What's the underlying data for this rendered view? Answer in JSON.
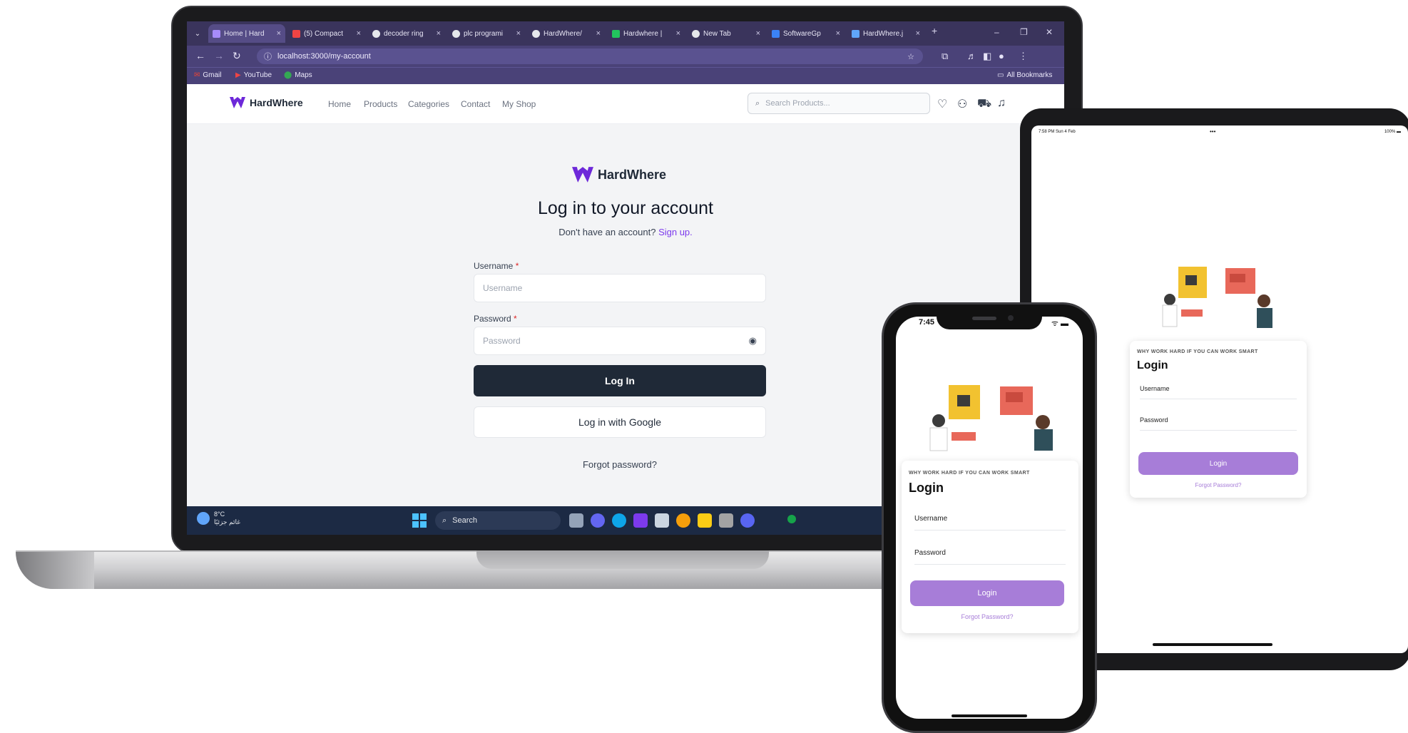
{
  "browser": {
    "tabs": [
      {
        "label": "Home | Hard",
        "active": true,
        "icon_color": "#a78bfa"
      },
      {
        "label": "(5) Compact",
        "active": false,
        "icon_color": "#ef4444"
      },
      {
        "label": "decoder ring",
        "active": false,
        "icon_color": "#e5e7eb"
      },
      {
        "label": "plc programi",
        "active": false,
        "icon_color": "#e5e7eb"
      },
      {
        "label": "HardWhere/",
        "active": false,
        "icon_color": "#e5e7eb"
      },
      {
        "label": "Hardwhere |",
        "active": false,
        "icon_color": "#22c55e"
      },
      {
        "label": "New Tab",
        "active": false,
        "icon_color": "#e5e7eb"
      },
      {
        "label": "SoftwareGp",
        "active": false,
        "icon_color": "#3b82f6"
      },
      {
        "label": "HardWhere.j",
        "active": false,
        "icon_color": "#60a5fa"
      }
    ],
    "url": "localhost:3000/my-account",
    "bookmarks": [
      {
        "label": "Gmail"
      },
      {
        "label": "YouTube"
      },
      {
        "label": "Maps"
      }
    ],
    "all_bookmarks_label": "All Bookmarks"
  },
  "site": {
    "brand": "HardWhere",
    "brand_color": "#6d28d9",
    "nav": [
      "Home",
      "Products",
      "Categories",
      "Contact",
      "My Shop"
    ],
    "search_placeholder": "Search Products..."
  },
  "login_page": {
    "title": "Log in to your account",
    "subtitle": "Don't have an account?",
    "signup_link": "Sign up.",
    "username_label": "Username",
    "username_placeholder": "Username",
    "password_label": "Password",
    "password_placeholder": "Password",
    "required_mark": "*",
    "login_button": "Log In",
    "google_button": "Log in with Google",
    "forgot": "Forgot password?"
  },
  "taskbar": {
    "temperature": "8°C",
    "weather_text": "غائم جزئيًا",
    "search_label": "Search"
  },
  "tablet": {
    "status_left": "7:58 PM  Sun 4 Feb",
    "status_right": "100%",
    "tagline": "WHY WORK HARD IF YOU CAN WORK SMART",
    "title": "Login",
    "username": "Username",
    "password": "Password",
    "button": "Login",
    "forgot": "Forgot Password?"
  },
  "phone": {
    "time": "7:45",
    "tagline": "WHY WORK HARD IF YOU CAN WORK SMART",
    "title": "Login",
    "username": "Username",
    "password": "Password",
    "button": "Login",
    "forgot": "Forgot Password?"
  }
}
